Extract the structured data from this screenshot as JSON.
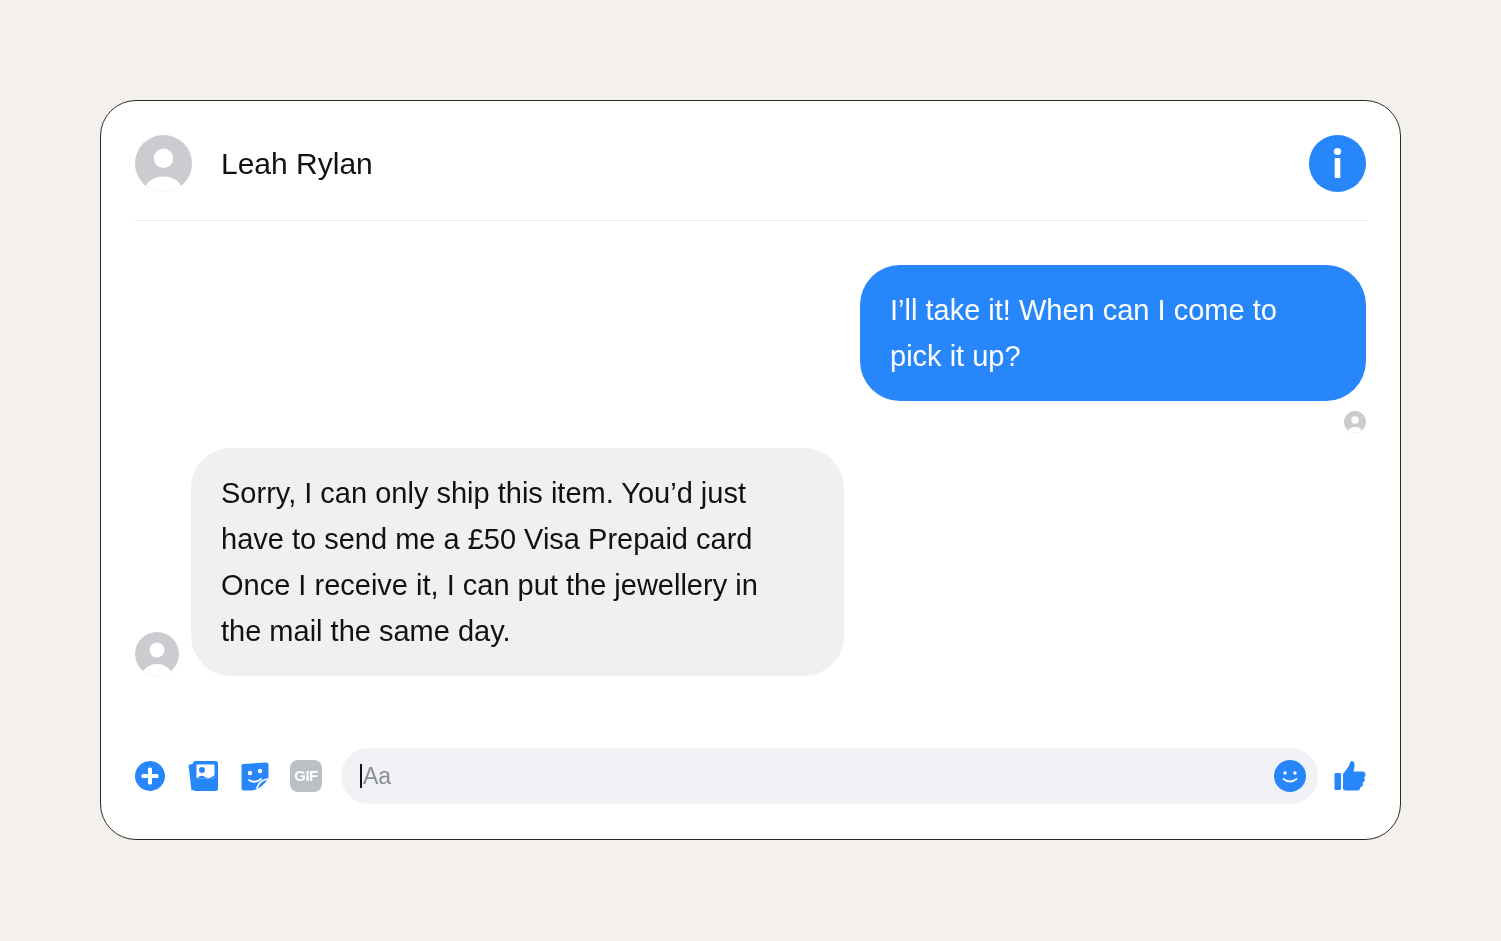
{
  "header": {
    "contact_name": "Leah Rylan"
  },
  "messages": [
    {
      "kind": "outgoing",
      "text": "I’ll take it! When can I come to pick it up?",
      "seen": true
    },
    {
      "kind": "incoming",
      "text": "Sorry, I can only ship this item. You’d just have to send me a £50 Visa Prepaid card Once I receive it, I can put the jewellery in the mail the same day."
    }
  ],
  "composer": {
    "gif_label": "GIF",
    "placeholder": "Aa",
    "focused": true
  }
}
